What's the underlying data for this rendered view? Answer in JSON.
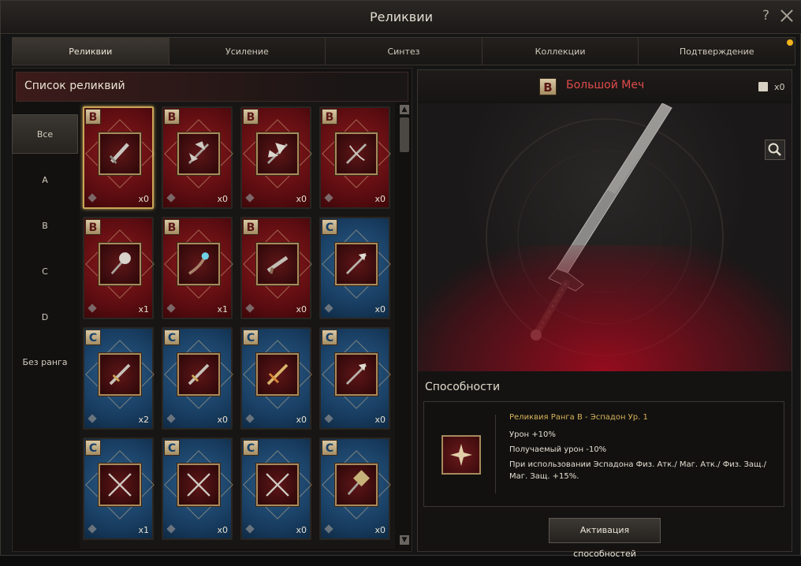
{
  "window": {
    "title": "Реликвии",
    "help": "?"
  },
  "tabs": [
    {
      "label": "Реликвии",
      "active": true
    },
    {
      "label": "Усиление"
    },
    {
      "label": "Синтез"
    },
    {
      "label": "Коллекции"
    },
    {
      "label": "Подтверждение"
    }
  ],
  "list": {
    "title": "Список реликвий"
  },
  "ranks": [
    "Все",
    "A",
    "B",
    "C",
    "D",
    "Без ранга"
  ],
  "cards": [
    {
      "rank": "B",
      "color": "red",
      "icon": "greatsword-icon",
      "count": "x0",
      "selected": true
    },
    {
      "rank": "B",
      "color": "red",
      "icon": "double-axe-icon",
      "count": "x0"
    },
    {
      "rank": "B",
      "color": "red",
      "icon": "battle-axe-icon",
      "count": "x0"
    },
    {
      "rank": "B",
      "color": "red",
      "icon": "crossbow-icon",
      "count": "x0"
    },
    {
      "rank": "B",
      "color": "red",
      "icon": "mace-icon",
      "count": "x1"
    },
    {
      "rank": "B",
      "color": "red",
      "icon": "staff-icon",
      "count": "x1"
    },
    {
      "rank": "B",
      "color": "red",
      "icon": "gun-icon",
      "count": "x0"
    },
    {
      "rank": "C",
      "color": "blue",
      "icon": "spear-icon",
      "count": "x0"
    },
    {
      "rank": "C",
      "color": "blue",
      "icon": "sword-icon",
      "count": "x2"
    },
    {
      "rank": "C",
      "color": "blue",
      "icon": "sword-icon",
      "count": "x0"
    },
    {
      "rank": "C",
      "color": "blue",
      "icon": "golden-sword-icon",
      "count": "x0"
    },
    {
      "rank": "C",
      "color": "blue",
      "icon": "spear-icon",
      "count": "x0"
    },
    {
      "rank": "C",
      "color": "blue",
      "icon": "crossed-swords-icon",
      "count": "x1"
    },
    {
      "rank": "C",
      "color": "blue",
      "icon": "crossed-swords-icon",
      "count": "x0"
    },
    {
      "rank": "C",
      "color": "blue",
      "icon": "crossed-swords-icon",
      "count": "x0"
    },
    {
      "rank": "C",
      "color": "blue",
      "icon": "hammer-icon",
      "count": "x0"
    }
  ],
  "detail": {
    "rank": "B",
    "name": "Большой Меч",
    "book_count": "x0",
    "abilities_title": "Способности",
    "ability_header": "Реликвия Ранга B - Эспадон Ур. 1",
    "ability_lines": [
      "Урон +10%",
      "Получаемый урон -10%",
      "При использовании Эспадона Физ. Атк./ Маг. Атк./ Физ. Защ./ Маг. Защ. +15%."
    ],
    "activate_label": "Активация способностей"
  },
  "colors": {
    "red_card": "#7a1418",
    "blue_card": "#1f4b74",
    "accent_gold": "#c9a658",
    "item_name": "#e14b4b"
  }
}
